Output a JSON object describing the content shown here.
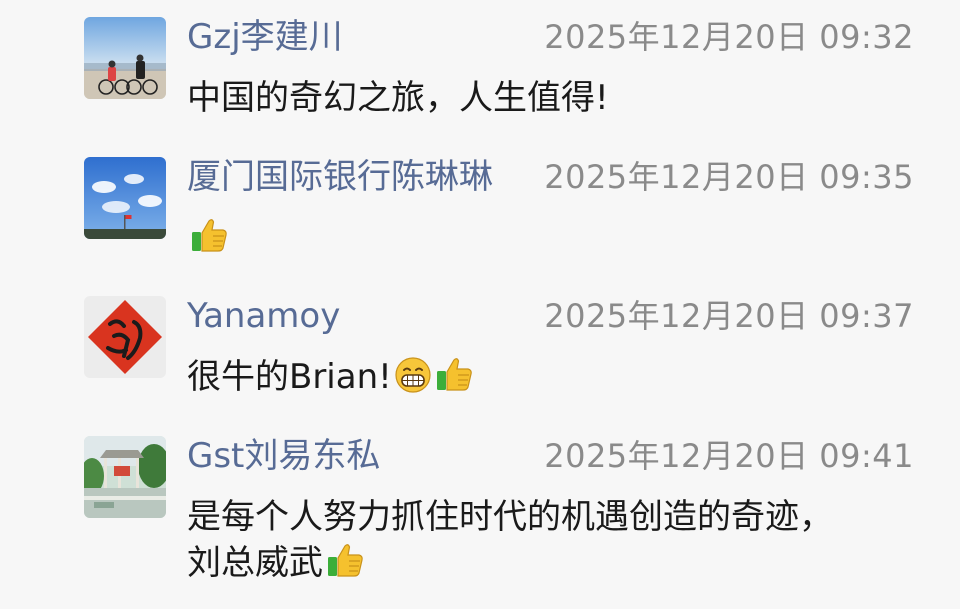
{
  "comments": [
    {
      "name": "Gzj李建川",
      "time": "2025年12月20日 09:32",
      "text": "中国的奇幻之旅，人生值得!",
      "avatar_icon": "beach-cyclists-photo",
      "emojis": []
    },
    {
      "name": "厦门国际银行陈琳琳",
      "time": "2025年12月20日 09:35",
      "text": "",
      "avatar_icon": "blue-sky-photo",
      "emojis": [
        "thumbs-up-icon"
      ]
    },
    {
      "name": "Yanamoy",
      "time": "2025年12月20日 09:37",
      "text": "很牛的Brian!",
      "avatar_icon": "fu-character-photo",
      "emojis": [
        "grin-icon",
        "thumbs-up-icon"
      ]
    },
    {
      "name": "Gst刘易东私",
      "time": "2025年12月20日 09:41",
      "text_line1": "是每个人努力抓住时代的机遇创造的奇迹，",
      "text_line2": "刘总威武",
      "avatar_icon": "garden-pavilion-photo",
      "emojis": [
        "thumbs-up-icon"
      ]
    }
  ],
  "colors": {
    "name": "#576b95",
    "time": "#8a8a8a",
    "text": "#1a1a1a",
    "background": "#f7f7f7"
  }
}
